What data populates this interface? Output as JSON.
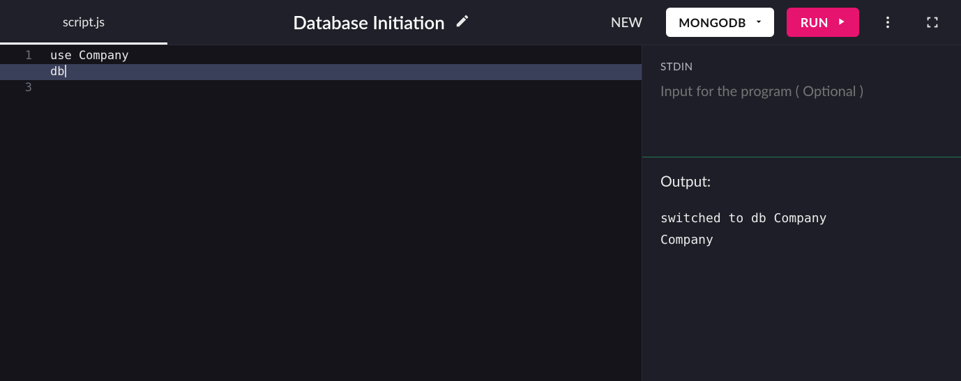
{
  "header": {
    "tab_name": "script.js",
    "title": "Database Initiation",
    "new_label": "NEW",
    "language": "MONGODB",
    "run_label": "RUN"
  },
  "editor": {
    "lines": [
      "use Company",
      "db",
      ""
    ],
    "active_line_index": 1
  },
  "panel": {
    "stdin_label": "STDIN",
    "stdin_placeholder": "Input for the program ( Optional )",
    "stdin_value": "",
    "output_label": "Output:",
    "output_text": "switched to db Company\nCompany"
  }
}
